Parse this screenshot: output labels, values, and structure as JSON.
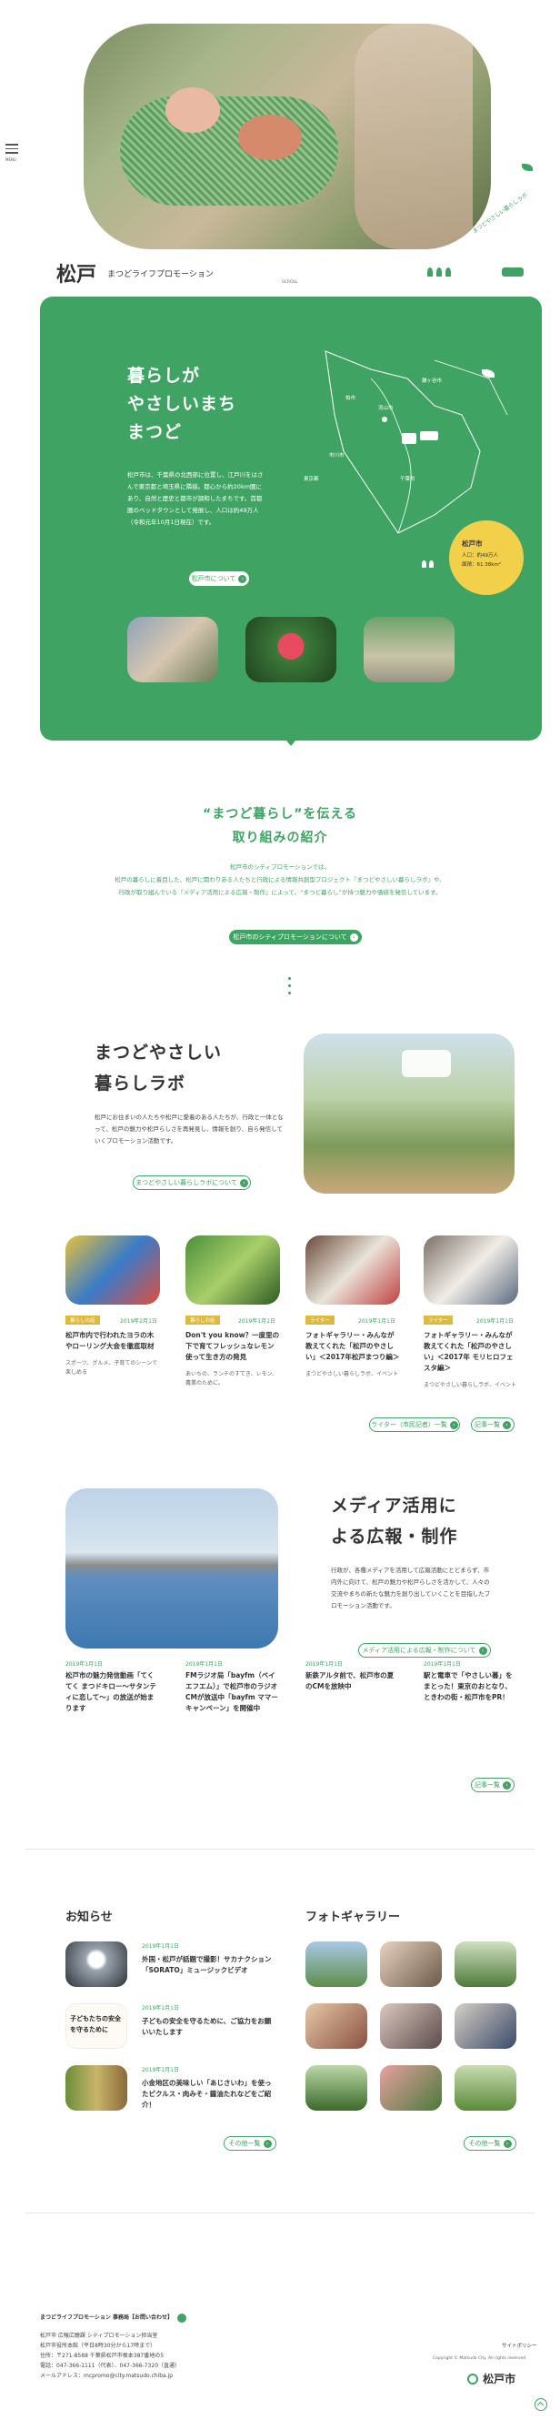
{
  "menu": {
    "label": "MENU"
  },
  "hero": {
    "logo_text": "松戸",
    "subtitle": "まつどライフプロモーション",
    "scroll_label": "SCROLL",
    "handwriting": "まつどやさしい暮らしラボ"
  },
  "about": {
    "title_lines": [
      "暮らしが",
      "やさしいまち",
      "まつど"
    ],
    "body": "松戸市は、千葉県の北西部に位置し、江戸川をはさんで東京都と埼玉県に隣接。都心から約20km圏にあり、自然と歴史と都市が調和したまちです。首都圏のベッドタウンとして発展し、人口は約49万人（令和元年10月1日現在）です。",
    "more_button": "松戸市について",
    "info_title": "松戸市",
    "info_population": "人口：約49万人",
    "info_area": "面積：61.38km²",
    "map_labels": [
      "柏市",
      "流山市",
      "鎌ヶ谷市",
      "市川市",
      "東京都",
      "千葉県"
    ]
  },
  "intro": {
    "title_line1": "“まつど暮らし”を伝える",
    "title_line2": "取り組みの紹介",
    "body_line1": "松戸市のシティプロモーションでは、",
    "body_line2": "松戸の暮らしに着目した、松戸に関わりある人たちと行政による情報共創型プロジェクト『まつどやさしい暮らしラボ』や、",
    "body_line3": "行政が取り組んでいる『メディア活用による広報・制作』によって、“まつど暮らし”が持つ魅力や価値を発信しています。",
    "button": "松戸市のシティプロモーションについて"
  },
  "lab": {
    "title_line1": "まつどやさしい",
    "title_line2": "暮らしラボ",
    "body": "松戸にお住まいの人たちや松戸に愛着のある人たちが、行政と一体となって、松戸の魅力や松戸らしさを再発見し、情報を創り、自ら発信していくプロモーション活動です。",
    "button": "まつどやさしい暮らしラボについて",
    "cards": [
      {
        "tag": "暮らしの話",
        "date": "2019年2月1日",
        "title": "松戸市内で行われたヨラの木やローリング大会を徹底取材",
        "desc": "スポーツ、グルメ、子育てのシーンで楽しめる"
      },
      {
        "tag": "暮らしの話",
        "date": "2019年1月1日",
        "title": "Don't you know？一度里の下で育てフレッシュなレモン使って生き方の発見",
        "desc": "あいちの、ランチのすてき、レモン、農業のために。"
      },
      {
        "tag": "ライター",
        "date": "2019年1月1日",
        "title": "フォトギャラリー・みんなが教えてくれた「松戸のやさしい」＜2017年松戸まつり編＞",
        "desc": "まつどやさしい暮らしラボ、イベント"
      },
      {
        "tag": "ライター",
        "date": "2019年1月1日",
        "title": "フォトギャラリー・みんなが教えてくれた「松戸のやさしい」＜2017年 モリヒロフェスタ編＞",
        "desc": "まつどやさしい暮らしラボ、イベント"
      }
    ],
    "writer_button": "ライター（市民記者）一覧",
    "list_button": "記事一覧"
  },
  "media": {
    "title_line1": "メディア活用に",
    "title_line2": "よる広報・制作",
    "body": "行政が、各種メディアを活用して広報活動にとどまらず、市内外に向けて、松戸の魅力や松戸らしさを活かして、人々の交流やまちの新たな魅力を創り出していくことを目指したプロモーション活動です。",
    "button": "メディア活用による広報・制作について",
    "news": [
      {
        "date": "2019年1月1日",
        "title": "松戸市の魅力発信動画「てくてく まつドキロー〜サタンティに恋して〜」の放送が始まります"
      },
      {
        "date": "2019年1月1日",
        "title": "FMラジオ局「bayfm（ベイエフエム）」で松戸市のラジオCMが放送中「bayfm ママーキャンペーン」を開催中"
      },
      {
        "date": "2019年1月1日",
        "title": "新鉄アルタ前で、松戸市の夏のCMを放映中"
      },
      {
        "date": "2019年1月1日",
        "title": "駅と電車で「やさしい暮」をまとった！東京のおとなり、ときわの街・松戸市をPR！"
      }
    ],
    "list_button": "記事一覧"
  },
  "notice": {
    "title": "お知らせ",
    "items": [
      {
        "date": "2019年1月1日",
        "title": "外国・松戸が話題で撮影！サカナクション「SORATO」ミュージックビデオ"
      },
      {
        "date": "2019年1月1日",
        "title": "子どもの安全を守るために、ご協力をお願いいたします"
      },
      {
        "date": "2019年1月1日",
        "title": "小金地区の美味しい「あじさいわ」を使ったピクルス・肉みそ・醤油たれなどをご紹介！"
      }
    ],
    "thumb_text": "子どもたちの安全を守るために",
    "button": "その他一覧"
  },
  "gallery": {
    "title": "フォトギャラリー",
    "button": "その他一覧"
  },
  "footer": {
    "org": "まつどライフプロモーション 事務局【お問い合わせ】",
    "lines": [
      "松戸市 広報広聴課 シティプロモーション担当室",
      "松戸市役所本館（平日8時30分から17時まで）",
      "住所：〒271-8588 千葉県松戸市根本387番地の5",
      "電話：047-366-1111（代表）、047-366-7320（直通）",
      "メールアドレス：mcpromo@city.matsudo.chiba.jp"
    ],
    "sitepolicy": "サイトポリシー",
    "copyright": "Copyright © Matsudo City. All rights reserved.",
    "logo": "松戸市"
  },
  "colors": {
    "accent": "#3fa463",
    "yellow": "#f2d04a",
    "tag": "#e0b93a"
  }
}
